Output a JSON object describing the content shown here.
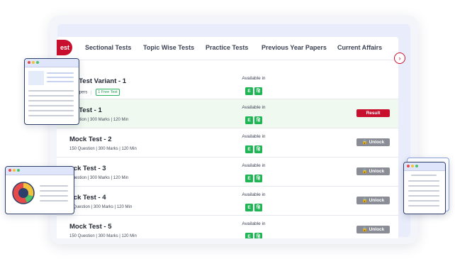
{
  "tabs": [
    {
      "label": "est",
      "active": true
    },
    {
      "label": "Sectional Tests"
    },
    {
      "label": "Topic Wise Tests"
    },
    {
      "label": "Practice Tests"
    },
    {
      "label": "Previous Year Papers"
    },
    {
      "label": "Current Affairs"
    }
  ],
  "tab_arrow_icon": "›",
  "rows": [
    {
      "title": "ck Test Variant - 1",
      "meta": "st Papers",
      "badge": "1 Free Test",
      "available_label": "Available in",
      "langs": [
        "E",
        "हि"
      ],
      "action": ""
    },
    {
      "title": "ck Test - 1",
      "meta": "Question | 300 Marks | 120 Min",
      "available_label": "Available in",
      "langs": [
        "E",
        "हि"
      ],
      "action": "Result"
    },
    {
      "title": "Mock Test - 2",
      "meta": "150 Question | 300 Marks | 120 Min",
      "available_label": "Available in",
      "langs": [
        "E",
        "हि"
      ],
      "action": "🔒 Unlock"
    },
    {
      "title": "ock Test - 3",
      "meta": "Question | 300 Marks | 120 Min",
      "available_label": "Available in",
      "langs": [
        "E",
        "हि"
      ],
      "action": "🔒 Unlock"
    },
    {
      "title": "ock Test - 4",
      "meta": "0 Question | 300 Marks | 120 Min",
      "available_label": "Available in",
      "langs": [
        "E",
        "हि"
      ],
      "action": "🔒 Unlock"
    },
    {
      "title": "Mock Test - 5",
      "meta": "150 Question | 300 Marks | 120 Min",
      "available_label": "Available in",
      "langs": [
        "E",
        "हि"
      ],
      "action": "🔒 Unlock"
    }
  ],
  "colors": {
    "accent": "#c8102e",
    "lang": "#20b554",
    "unlock": "#8a8d96"
  }
}
